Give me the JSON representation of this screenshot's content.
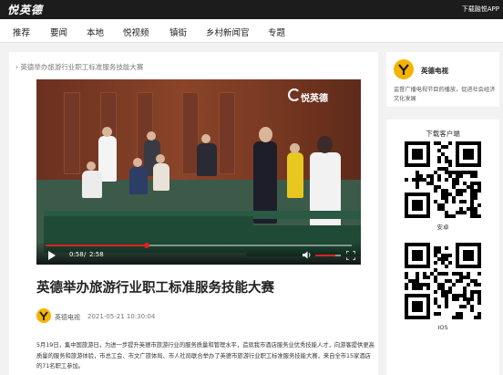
{
  "header": {
    "logo": "悦英德",
    "download_link": "下载融悦APP"
  },
  "nav": {
    "items": [
      "推荐",
      "要闻",
      "本地",
      "悦视频",
      "镇街",
      "乡村新闻官",
      "专题"
    ]
  },
  "breadcrumb": "英德举办旅游行业职工标准服务技能大赛",
  "video": {
    "watermark": "悦英德",
    "current_time": "0:58",
    "separator": "/",
    "duration": "2:58",
    "progress": 0.33,
    "volume": 0.8
  },
  "article": {
    "title": "英德举办旅游行业职工标准服务技能大赛",
    "author": "英德电视",
    "date": "2021-05-21 10:30:04",
    "body": "5月19日，集中国旅游日，为进一步提升英德市旅游行业的服务质量和管理水平，造就我市酒店服务业优秀技能人才，向游客提供更高质量的服务和旅游体验，市总工会、市文广旅体局、市人社局联合举办了英德市旅游行业职工标准服务技能大赛，来自全市15家酒店的71名职工参加。"
  },
  "sidebar": {
    "channel_name": "英德电视",
    "channel_desc": "监督广播电视节目的播放，促进社会经济文化发展",
    "download_title": "下载客户端",
    "android_label": "安卓",
    "ios_label": "IOS"
  },
  "colors": {
    "accent": "#e02020",
    "brand": "#f4b400",
    "topbar": "#1c1c1c"
  }
}
